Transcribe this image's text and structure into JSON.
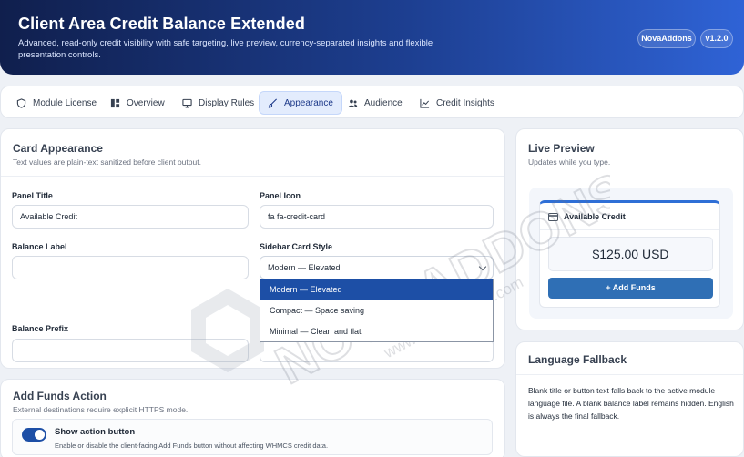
{
  "header": {
    "title": "Client Area Credit Balance Extended",
    "subtitle": "Advanced, read-only credit visibility with safe targeting, live preview, currency-separated insights and flexible presentation controls.",
    "brand_badge": "NovaAddons",
    "version_badge": "v1.2.0"
  },
  "tabs": [
    {
      "label": "Module License",
      "icon": "shield-icon"
    },
    {
      "label": "Overview",
      "icon": "grid-icon"
    },
    {
      "label": "Display Rules",
      "icon": "monitor-icon"
    },
    {
      "label": "Appearance",
      "icon": "brush-icon",
      "active": true
    },
    {
      "label": "Audience",
      "icon": "users-icon"
    },
    {
      "label": "Credit Insights",
      "icon": "chart-icon"
    }
  ],
  "appearance": {
    "title": "Card Appearance",
    "subtitle": "Text values are plain-text sanitized before client output.",
    "panel_title_label": "Panel Title",
    "panel_title_value": "Available Credit",
    "panel_icon_label": "Panel Icon",
    "panel_icon_value": "fa fa-credit-card",
    "balance_label_label": "Balance Label",
    "balance_label_value": "",
    "sidebar_style_label": "Sidebar Card Style",
    "sidebar_style_value": "Modern — Elevated",
    "sidebar_style_options": [
      "Modern — Elevated",
      "Compact — Space saving",
      "Minimal — Clean and flat"
    ],
    "balance_prefix_label": "Balance Prefix",
    "balance_prefix_value": ""
  },
  "add_funds": {
    "title": "Add Funds Action",
    "subtitle": "External destinations require explicit HTTPS mode.",
    "toggle_label": "Show action button",
    "toggle_desc": "Enable or disable the client-facing Add Funds button without affecting WHMCS credit data.",
    "toggle_on": true
  },
  "preview": {
    "title": "Live Preview",
    "subtitle": "Updates while you type.",
    "card_title": "Available Credit",
    "amount": "$125.00 USD",
    "button_label": "+ Add Funds"
  },
  "fallback": {
    "title": "Language Fallback",
    "text": "Blank title or button text falls back to the active module language file. A blank balance label remains hidden. English is always the final fallback."
  },
  "watermark": {
    "text": "NOVA ADDONS",
    "url": "www.novaaddons.com"
  },
  "colors": {
    "accent": "#1d4fa6",
    "header_start": "#101f4d",
    "header_end": "#2f63d6"
  }
}
